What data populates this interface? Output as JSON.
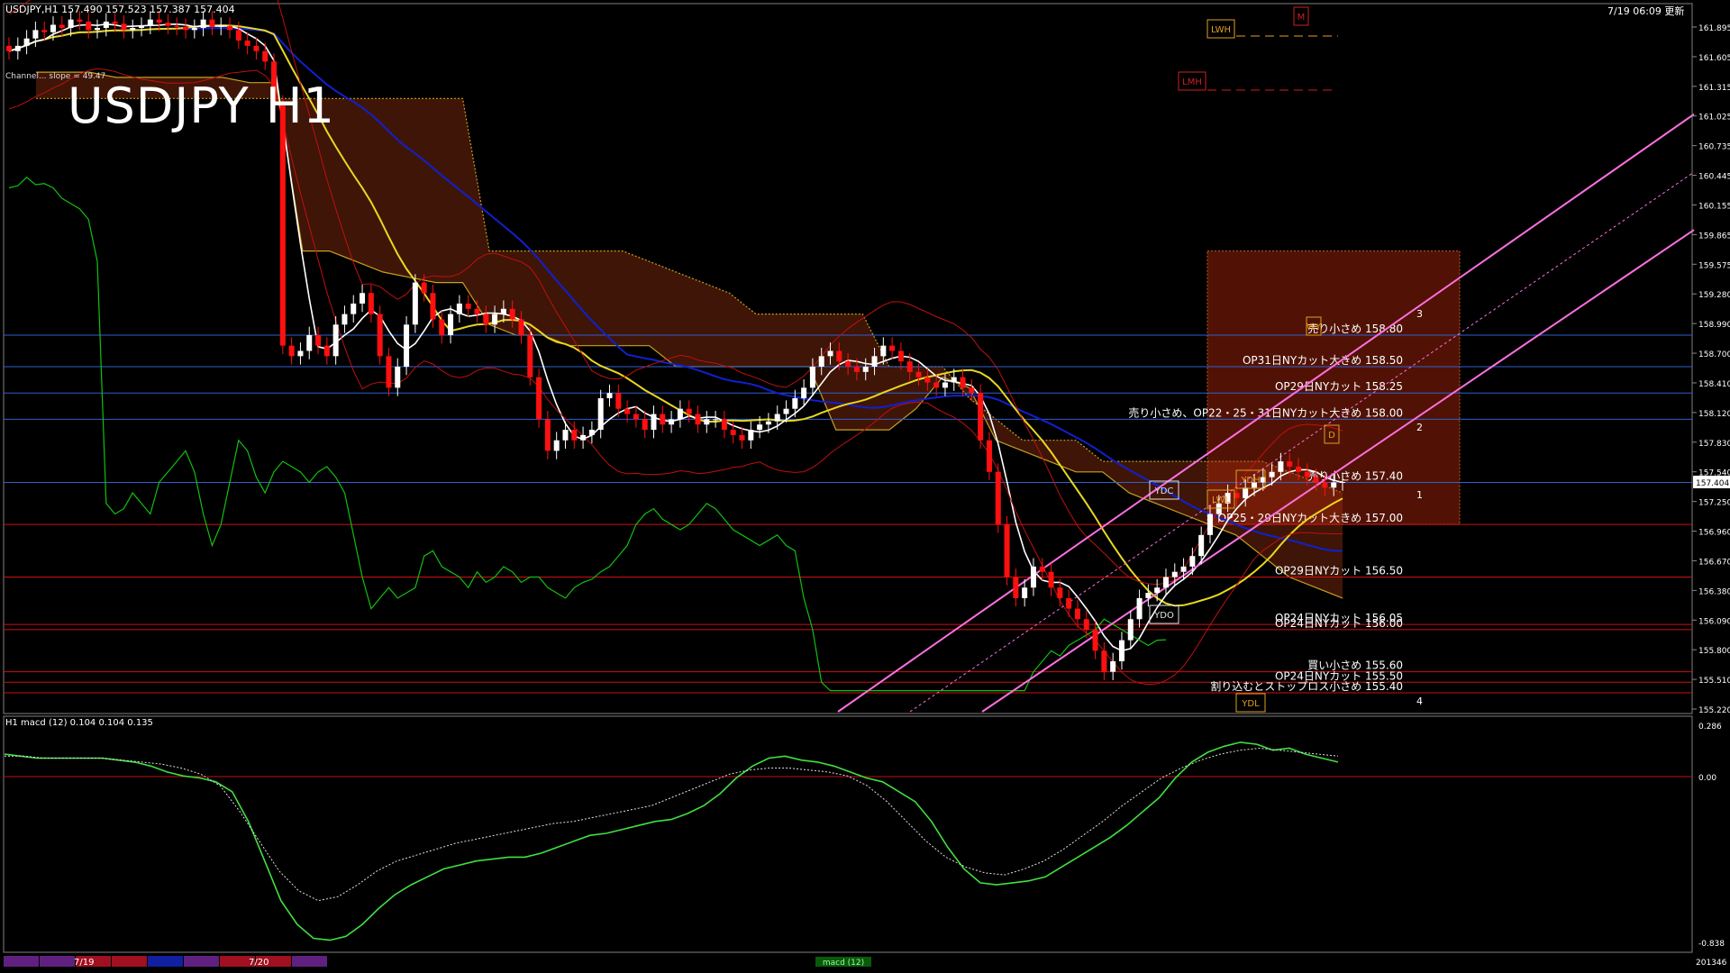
{
  "header": {
    "symbol_line": "USDJPY,H1  157.490 157.523 157.387 157.404",
    "datetime": "7/19 06:09",
    "update_label": "更新",
    "big_title": "USDJPY H1",
    "indicator_note": "Channel... slope = 49.47"
  },
  "macd_header": "H1  macd (12) 0.104 0.104 0.135",
  "price_axis": {
    "labels": [
      "161.895",
      "161.605",
      "161.315",
      "161.025",
      "160.735",
      "160.445",
      "160.155",
      "159.865",
      "159.575",
      "159.280",
      "158.990",
      "158.700",
      "158.410",
      "158.120",
      "157.830",
      "157.540",
      "157.250",
      "156.960",
      "156.670",
      "156.380",
      "156.090",
      "155.800",
      "155.510",
      "155.220"
    ],
    "current_price": "157.404"
  },
  "macd_axis": {
    "labels": [
      "0.286",
      "0.00",
      "-0.838"
    ]
  },
  "bottom_bar": {
    "dates": [
      "7/19",
      "7/20"
    ],
    "macd_button": "macd (12)",
    "counter": "201346"
  },
  "levels": [
    {
      "text": "売り小さめ 158.80",
      "price": 158.8,
      "color": "#3060d0"
    },
    {
      "text": "OP31日NYカット大きめ 158.50",
      "price": 158.5,
      "color": "#3060d0"
    },
    {
      "text": "OP29日NYカット 158.25",
      "price": 158.25,
      "color": "#3060d0"
    },
    {
      "text": "売り小さめ、OP22・25・31日NYカット大きめ 158.00",
      "price": 158.0,
      "color": "#3060d0"
    },
    {
      "text": "売り小さめ 157.40",
      "price": 157.4,
      "color": "#3060d0"
    },
    {
      "text": "OP25・29日NYカット大きめ 157.00",
      "price": 157.0,
      "color": "#d01010"
    },
    {
      "text": "OP29日NYカット 156.50",
      "price": 156.5,
      "color": "#d01010"
    },
    {
      "text": "OP24日NYカット 156.05",
      "price": 156.05,
      "color": "#d01010"
    },
    {
      "text": "OP24日NYカット 156.00",
      "price": 156.0,
      "color": "#d01010"
    },
    {
      "text": "買い小さめ 155.60",
      "price": 155.6,
      "color": "#d01010"
    },
    {
      "text": "OP24日NYカット 155.50",
      "price": 155.5,
      "color": "#d01010"
    },
    {
      "text": "割り込むとストップロス小さめ 155.40",
      "price": 155.4,
      "color": "#d01010"
    }
  ],
  "markers": {
    "lwh": "LWH",
    "lmh": "LMH",
    "m": "M",
    "ydc": "YDC",
    "ydh": "YDH",
    "lwl": "LWL",
    "ydo": "YDO",
    "ydl": "YDL",
    "wy": "WY",
    "d": "D",
    "projections": [
      "3",
      "2",
      "1",
      "4"
    ]
  },
  "chart_data": {
    "type": "line",
    "title": "USDJPY H1",
    "instrument": "USDJPY",
    "timeframe": "H1",
    "ohlc_current": {
      "open": 157.49,
      "high": 157.523,
      "low": 157.387,
      "close": 157.404
    },
    "ylim": [
      155.22,
      161.9
    ],
    "close_series": [
      161.5,
      161.55,
      161.62,
      161.7,
      161.68,
      161.75,
      161.72,
      161.8,
      161.78,
      161.7,
      161.72,
      161.78,
      161.76,
      161.7,
      161.72,
      161.74,
      161.8,
      161.77,
      161.74,
      161.73,
      161.7,
      161.72,
      161.8,
      161.73,
      161.74,
      161.7,
      161.6,
      161.55,
      161.5,
      161.4,
      161.0,
      158.7,
      158.6,
      158.65,
      158.8,
      158.7,
      158.6,
      158.9,
      159.0,
      159.1,
      159.2,
      159.0,
      158.6,
      158.3,
      158.5,
      158.9,
      159.3,
      159.2,
      158.95,
      158.8,
      159.0,
      159.1,
      159.05,
      159.0,
      158.9,
      159.0,
      159.05,
      158.95,
      158.8,
      158.4,
      158.0,
      157.7,
      157.8,
      157.9,
      157.8,
      157.85,
      157.9,
      158.2,
      158.25,
      158.1,
      158.05,
      158.0,
      157.9,
      158.05,
      157.95,
      158.0,
      158.1,
      158.05,
      157.95,
      158.0,
      158.0,
      157.9,
      157.85,
      157.8,
      157.9,
      157.95,
      157.98,
      158.05,
      158.1,
      158.2,
      158.3,
      158.5,
      158.6,
      158.65,
      158.55,
      158.5,
      158.45,
      158.5,
      158.6,
      158.7,
      158.65,
      158.55,
      158.45,
      158.4,
      158.35,
      158.3,
      158.35,
      158.4,
      158.3,
      158.25,
      157.8,
      157.5,
      157.0,
      156.5,
      156.3,
      156.4,
      156.6,
      156.55,
      156.4,
      156.3,
      156.2,
      156.1,
      156.0,
      155.8,
      155.6,
      155.7,
      155.9,
      156.1,
      156.3,
      156.35,
      156.4,
      156.5,
      156.55,
      156.6,
      156.7,
      156.9,
      157.1,
      157.2,
      157.3,
      157.25,
      157.35,
      157.4,
      157.45,
      157.5,
      157.6,
      157.55,
      157.5,
      157.45,
      157.4,
      157.35,
      157.4,
      157.404
    ],
    "series": [
      {
        "name": "MA (white)",
        "color": "#ffffff"
      },
      {
        "name": "MA (yellow)",
        "color": "#e8d820"
      },
      {
        "name": "MA (blue)",
        "color": "#1020d0"
      },
      {
        "name": "Chikou (green)",
        "color": "#10c010"
      }
    ],
    "macd": {
      "ylim": [
        -0.838,
        0.286
      ],
      "values": [
        0.14,
        0.13,
        0.12,
        0.12,
        0.12,
        0.12,
        0.12,
        0.11,
        0.1,
        0.08,
        0.05,
        0.03,
        0.02,
        0.0,
        -0.05,
        -0.2,
        -0.4,
        -0.6,
        -0.72,
        -0.79,
        -0.8,
        -0.78,
        -0.72,
        -0.64,
        -0.57,
        -0.52,
        -0.48,
        -0.44,
        -0.42,
        -0.4,
        -0.39,
        -0.38,
        -0.38,
        -0.36,
        -0.33,
        -0.3,
        -0.27,
        -0.26,
        -0.24,
        -0.22,
        -0.2,
        -0.19,
        -0.16,
        -0.12,
        -0.06,
        0.02,
        0.08,
        0.12,
        0.13,
        0.11,
        0.1,
        0.08,
        0.05,
        0.02,
        0.0,
        -0.05,
        -0.1,
        -0.2,
        -0.33,
        -0.44,
        -0.51,
        -0.52,
        -0.51,
        -0.5,
        -0.48,
        -0.43,
        -0.38,
        -0.33,
        -0.28,
        -0.22,
        -0.15,
        -0.08,
        0.02,
        0.1,
        0.15,
        0.18,
        0.2,
        0.19,
        0.16,
        0.17,
        0.14,
        0.12,
        0.1
      ],
      "signal": [
        0.13,
        0.13,
        0.12,
        0.12,
        0.12,
        0.12,
        0.11,
        0.1,
        0.09,
        0.07,
        0.04,
        -0.02,
        -0.15,
        -0.3,
        -0.45,
        -0.55,
        -0.6,
        -0.58,
        -0.52,
        -0.45,
        -0.4,
        -0.37,
        -0.34,
        -0.31,
        -0.29,
        -0.27,
        -0.25,
        -0.23,
        -0.21,
        -0.2,
        -0.18,
        -0.16,
        -0.14,
        -0.12,
        -0.08,
        -0.04,
        0.0,
        0.04,
        0.06,
        0.07,
        0.07,
        0.06,
        0.05,
        0.03,
        -0.02,
        -0.1,
        -0.2,
        -0.3,
        -0.38,
        -0.43,
        -0.46,
        -0.47,
        -0.44,
        -0.4,
        -0.34,
        -0.27,
        -0.2,
        -0.12,
        -0.05,
        0.02,
        0.07,
        0.11,
        0.14,
        0.16,
        0.17,
        0.16,
        0.15,
        0.14,
        0.13
      ]
    }
  }
}
